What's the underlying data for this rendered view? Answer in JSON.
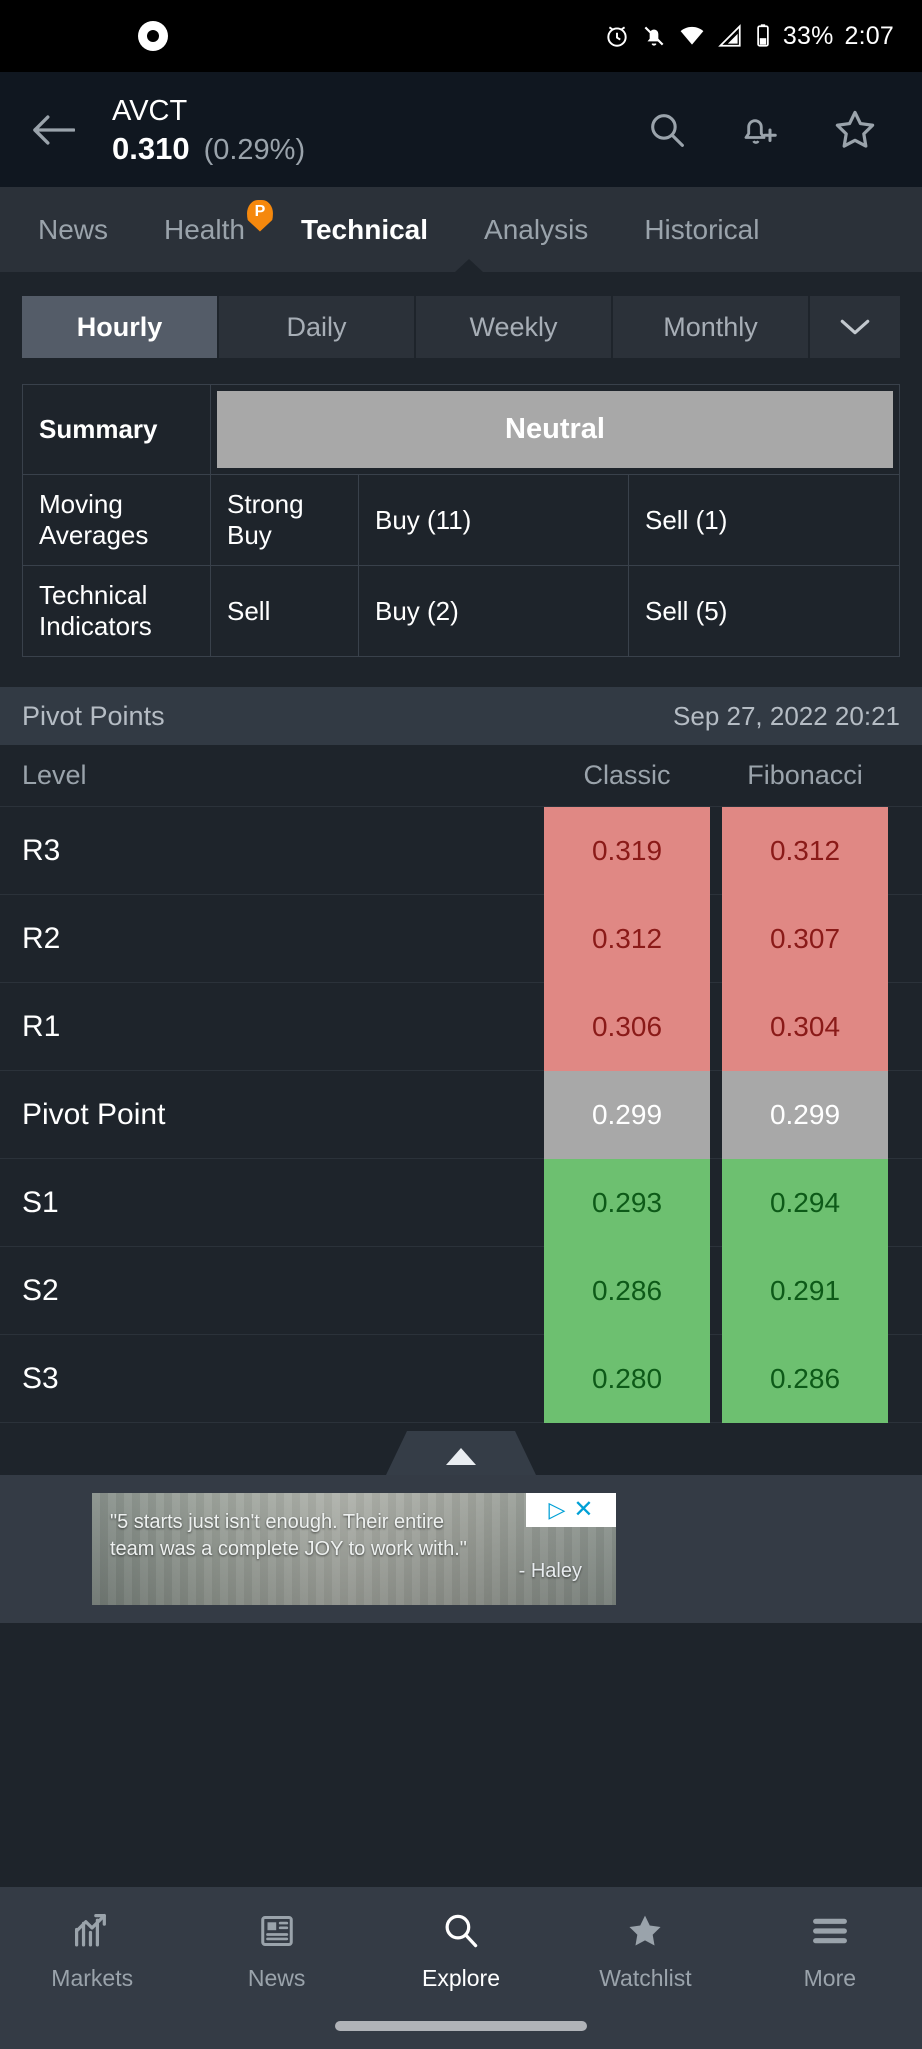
{
  "status_bar": {
    "app_icon": "chrome-icon",
    "icons": [
      "alarm-icon",
      "notifications-off-icon",
      "wifi-icon",
      "signal-icon",
      "battery-icon"
    ],
    "battery": "33%",
    "time": "2:07"
  },
  "header": {
    "back": "back-arrow-icon",
    "symbol": "AVCT",
    "price": "0.310",
    "change": "(0.29%)",
    "actions": [
      {
        "name": "search-icon",
        "label": "Search"
      },
      {
        "name": "add-alert-icon",
        "label": "Add alert"
      },
      {
        "name": "star-icon",
        "label": "Add to watchlist"
      }
    ]
  },
  "tabs": [
    {
      "label": "News",
      "active": false,
      "badge": null
    },
    {
      "label": "Health",
      "active": false,
      "badge": "P"
    },
    {
      "label": "Technical",
      "active": true,
      "badge": null
    },
    {
      "label": "Analysis",
      "active": false,
      "badge": null
    },
    {
      "label": "Historical",
      "active": false,
      "badge": null
    }
  ],
  "timeframes": {
    "options": [
      "Hourly",
      "Daily",
      "Weekly",
      "Monthly"
    ],
    "selected": "Hourly",
    "more_icon": "chevron-down-icon"
  },
  "summary_table": {
    "rows": [
      {
        "label": "Summary",
        "verdict": "Neutral",
        "buy": "",
        "sell": "",
        "type": "summary"
      },
      {
        "label": "Moving Averages",
        "verdict": "Strong Buy",
        "buy": "Buy (11)",
        "sell": "Sell (1)",
        "type": "data"
      },
      {
        "label": "Technical Indicators",
        "verdict": "Sell",
        "buy": "Buy (2)",
        "sell": "Sell (5)",
        "type": "data"
      }
    ]
  },
  "pivot_points": {
    "title": "Pivot Points",
    "timestamp": "Sep 27, 2022 20:21",
    "columns": [
      "Level",
      "Classic",
      "Fibonacci"
    ],
    "rows": [
      {
        "level": "R3",
        "classic": "0.319",
        "fibonacci": "0.312",
        "kind": "resistance"
      },
      {
        "level": "R2",
        "classic": "0.312",
        "fibonacci": "0.307",
        "kind": "resistance"
      },
      {
        "level": "R1",
        "classic": "0.306",
        "fibonacci": "0.304",
        "kind": "resistance"
      },
      {
        "level": "Pivot Point",
        "classic": "0.299",
        "fibonacci": "0.299",
        "kind": "pivot"
      },
      {
        "level": "S1",
        "classic": "0.293",
        "fibonacci": "0.294",
        "kind": "support"
      },
      {
        "level": "S2",
        "classic": "0.286",
        "fibonacci": "0.291",
        "kind": "support"
      },
      {
        "level": "S3",
        "classic": "0.280",
        "fibonacci": "0.286",
        "kind": "support"
      }
    ]
  },
  "collapse_handle": {
    "icon": "chevron-up-icon"
  },
  "advertisement": {
    "quote": "\"5 starts just isn't enough. Their entire team was a complete JOY to work with.\"",
    "attribution": "- Haley",
    "adchoices_icon": "adchoices-icon",
    "close_icon": "close-icon"
  },
  "bottom_nav": [
    {
      "label": "Markets",
      "icon": "chart-icon",
      "active": false
    },
    {
      "label": "News",
      "icon": "newspaper-icon",
      "active": false
    },
    {
      "label": "Explore",
      "icon": "search-icon",
      "active": true
    },
    {
      "label": "Watchlist",
      "icon": "star-icon",
      "active": false
    },
    {
      "label": "More",
      "icon": "hamburger-icon",
      "active": false
    }
  ],
  "colors": {
    "background": "#1e242b",
    "panel": "#2b3139",
    "resistance": "#e08884",
    "resistance_text": "#8a1a18",
    "pivot": "#a8a8a8",
    "support": "#6dc070",
    "support_text": "#0d5a18",
    "accent_pro": "#f5880d",
    "adchoices_blue": "#00a0d6"
  }
}
